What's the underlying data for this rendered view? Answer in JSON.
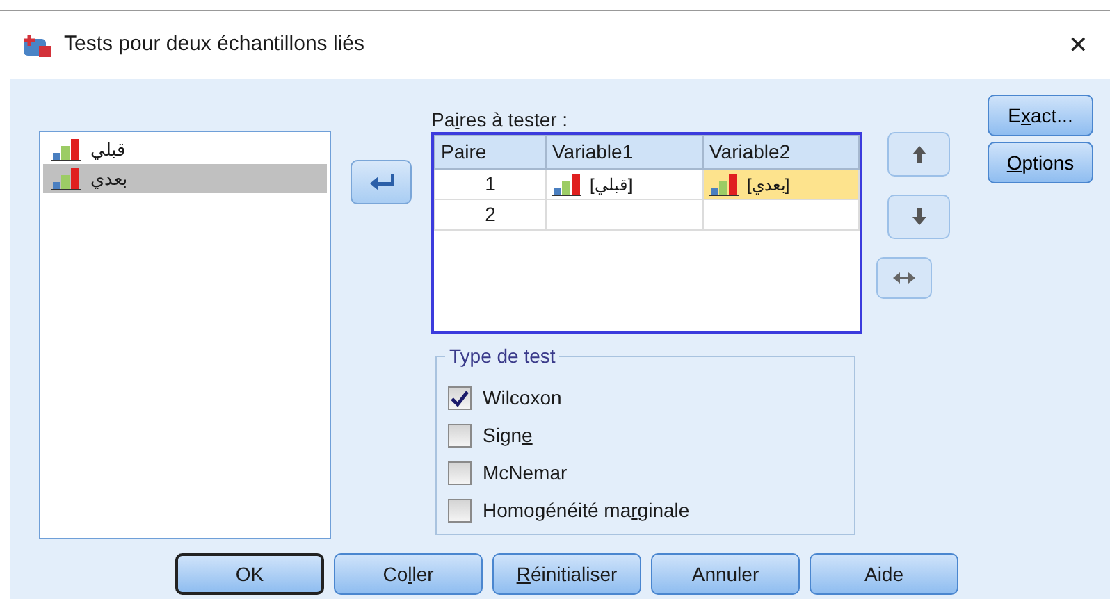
{
  "window": {
    "title": "Tests pour deux échantillons liés",
    "close": "✕"
  },
  "variables": [
    {
      "name": "قبلي",
      "selected": false
    },
    {
      "name": "بعدي",
      "selected": true
    }
  ],
  "move_button": {
    "disabled": false
  },
  "pairs": {
    "label": {
      "before": "Pa",
      "key": "i",
      "after": "res à tester :"
    },
    "columns": [
      "Paire",
      "Variable1",
      "Variable2"
    ],
    "rows": [
      {
        "cells": [
          {
            "text": "1",
            "selected": false
          },
          {
            "text": "[قبلي]",
            "selected": false
          },
          {
            "text": "[بعدي]",
            "selected": true
          }
        ]
      },
      {
        "cells": [
          {
            "text": "2",
            "selected": false
          },
          {
            "text": "",
            "selected": false
          },
          {
            "text": "",
            "selected": false
          }
        ]
      }
    ]
  },
  "order_buttons": [
    {
      "kind": "up",
      "disabled": true
    },
    {
      "kind": "down",
      "disabled": true
    },
    {
      "kind": "swap",
      "disabled": true
    }
  ],
  "side_buttons": [
    {
      "label": {
        "before": "E",
        "key": "x",
        "after": "act..."
      }
    },
    {
      "label": {
        "key": "O",
        "after": "ptions"
      }
    }
  ],
  "test_type": {
    "title": "Type de test",
    "options": [
      {
        "label": "Wilcoxon",
        "checked": true
      },
      {
        "label": {
          "before": "Sign",
          "key": "e"
        },
        "checked": false
      },
      {
        "label": "McNemar",
        "checked": false
      },
      {
        "label": {
          "before": "Homogénéité ma",
          "key": "r",
          "after": "ginale"
        },
        "checked": false
      }
    ]
  },
  "buttons": [
    {
      "label": "OK",
      "default": true
    },
    {
      "label": {
        "before": "Co",
        "key": "l",
        "after": "ler"
      },
      "default": false
    },
    {
      "label": {
        "key": "R",
        "after": "éinitialiser"
      },
      "default": false
    },
    {
      "label": "Annuler",
      "default": false
    },
    {
      "label": "Aide",
      "default": false
    }
  ]
}
